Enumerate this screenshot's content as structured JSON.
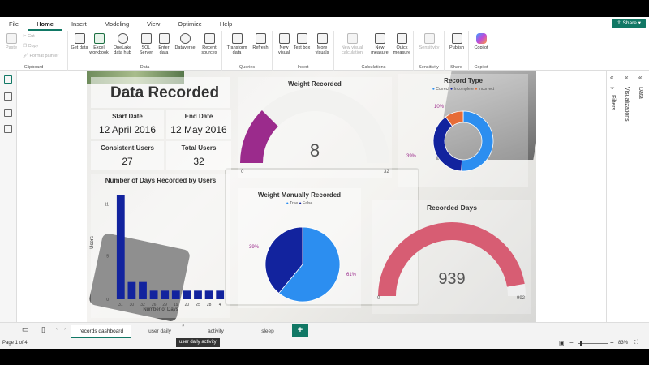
{
  "menu": {
    "items": [
      "File",
      "Home",
      "Insert",
      "Modeling",
      "View",
      "Optimize",
      "Help"
    ],
    "active": "Home",
    "share": "Share"
  },
  "ribbon": {
    "clipboard": {
      "paste": "Paste",
      "cut": "Cut",
      "copy": "Copy",
      "format_painter": "Format painter",
      "label": "Clipboard"
    },
    "data": {
      "get_data": "Get data",
      "excel": "Excel workbook",
      "onelake": "OneLake data hub",
      "sql": "SQL Server",
      "enter": "Enter data",
      "dataverse": "Dataverse",
      "recent": "Recent sources",
      "label": "Data"
    },
    "queries": {
      "transform": "Transform data",
      "refresh": "Refresh",
      "label": "Queries"
    },
    "insert": {
      "new_visual": "New visual",
      "text_box": "Text box",
      "more_visuals": "More visuals",
      "label": "Insert"
    },
    "calculations": {
      "new_visual_calc": "New visual calculation",
      "new_measure": "New measure",
      "quick_measure": "Quick measure",
      "label": "Calculations"
    },
    "sensitivity": {
      "btn": "Sensitivity",
      "label": "Sensitivity"
    },
    "share": {
      "publish": "Publish",
      "label": "Share"
    },
    "copilot": {
      "btn": "Copilot",
      "label": "Copilot"
    }
  },
  "report": {
    "title": "Data Recorded",
    "start_date": {
      "label": "Start Date",
      "value": "12 April 2016"
    },
    "end_date": {
      "label": "End Date",
      "value": "12 May 2016"
    },
    "consistent_users": {
      "label": "Consistent Users",
      "value": "27"
    },
    "total_users": {
      "label": "Total Users",
      "value": "32"
    },
    "weight_gauge": {
      "title": "Weight Recorded",
      "value": "8",
      "min": "0",
      "max": "32",
      "fraction": 0.25
    },
    "record_type": {
      "title": "Record Type",
      "legend": [
        "Correct",
        "Incomplete",
        "Incorrect"
      ],
      "label_left": "39%",
      "label_top": "10%"
    },
    "manual_weight": {
      "title": "Weight Manually Recorded",
      "legend": [
        "True",
        "False"
      ],
      "label_left": "39%",
      "label_right": "61%"
    },
    "recorded_days": {
      "title": "Recorded Days",
      "value": "939",
      "min": "0",
      "max": "992",
      "fraction": 0.947
    },
    "days_chart": {
      "title": "Number of Days Recorded by Users",
      "xlabel": "Number of Days",
      "ylabel": "Users"
    }
  },
  "colors": {
    "accent": "#117865",
    "navy": "#12239e",
    "blue": "#2c8ef0",
    "magenta": "#9b2b8c",
    "pink": "#d75d73",
    "orange": "#e66c37"
  },
  "chart_data": [
    {
      "type": "bar",
      "title": "Number of Days Recorded by Users",
      "xlabel": "Number of Days",
      "ylabel": "Users",
      "categories": [
        "31",
        "30",
        "32",
        "26",
        "29",
        "19",
        "20",
        "25",
        "28",
        "4"
      ],
      "values": [
        12,
        2,
        2,
        1,
        1,
        1,
        1,
        1,
        1,
        1
      ],
      "ylim": [
        0,
        12
      ],
      "yticks": [
        "0",
        "5",
        "11"
      ]
    },
    {
      "type": "pie",
      "title": "Record Type",
      "labels": [
        "Correct",
        "Incomplete",
        "Incorrect"
      ],
      "values": [
        51,
        39,
        10
      ]
    },
    {
      "type": "pie",
      "title": "Weight Manually Recorded",
      "labels": [
        "True",
        "False"
      ],
      "values": [
        39,
        61
      ]
    }
  ],
  "panes": {
    "filters": "Filters",
    "visualizations": "Visualizations",
    "data": "Data"
  },
  "tabs": [
    "records dashboard",
    "user daily activity",
    "activity dashboard",
    "sleep records"
  ],
  "tooltip": "user daily activity",
  "status": {
    "page": "Page 1 of 4",
    "zoom": "83%"
  }
}
